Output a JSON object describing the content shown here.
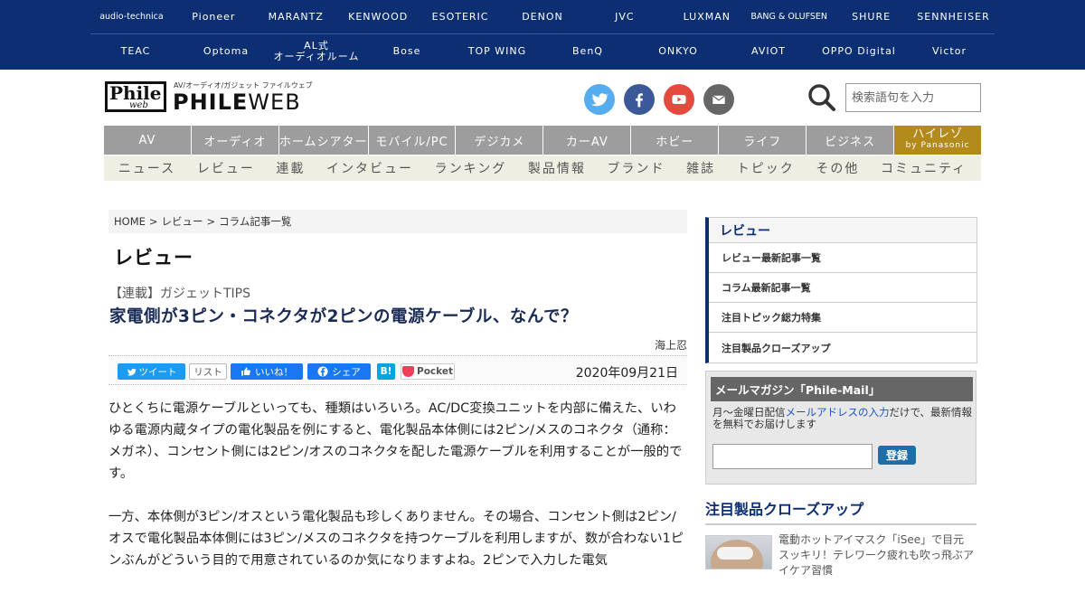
{
  "brandbar": {
    "row1": [
      "audio-technica",
      "Pioneer",
      "MARANTZ",
      "KENWOOD",
      "ESOTERIC",
      "DENON",
      "JVC",
      "LUXMAN",
      "BANG & OLUFSEN",
      "SHURE",
      "SENNHEISER"
    ],
    "row2": [
      "TEAC",
      "Optoma",
      "AL式\nオーディオルーム",
      "Bose",
      "TOP WING",
      "BenQ",
      "ONKYO",
      "AVIOT",
      "OPPO Digital",
      "Victor"
    ]
  },
  "logo": {
    "box_letters": "Phile",
    "box_sub": "web",
    "tagline": "AV/オーディオ/ガジェット ファイルウェブ",
    "name_bold": "PHILE",
    "name_light": "WEB"
  },
  "social_icons": [
    "twitter-icon",
    "facebook-icon",
    "youtube-icon",
    "mail-icon"
  ],
  "colors": {
    "twitter": "#55acee",
    "facebook": "#3b5998",
    "youtube": "#e24b3d",
    "mail": "#666666",
    "brandbar": "#0c2e72",
    "hires": "#b38a1c"
  },
  "search": {
    "placeholder": "検索語句を入力"
  },
  "categories": [
    "AV",
    "オーディオ",
    "ホームシアター",
    "モバイル/PC",
    "デジカメ",
    "カーAV",
    "ホビー",
    "ライフ",
    "ビジネス"
  ],
  "hires": {
    "label": "ハイレゾ",
    "sub": "by Panasonic"
  },
  "subnav": [
    "ニュース",
    "レビュー",
    "連載",
    "インタビュー",
    "ランキング",
    "製品情報",
    "ブランド",
    "雑誌",
    "トピック",
    "その他",
    "コミュニティ"
  ],
  "breadcrumb": {
    "home": "HOME",
    "sep": ">",
    "review": "レビュー",
    "column": "コラム記事一覧"
  },
  "article": {
    "section": "レビュー",
    "series": "【連載】ガジェットTIPS",
    "title": "家電側が3ピン・コネクタが2ピンの電源ケーブル、なんで？",
    "author": "海上忍",
    "date": "2020年09月21日",
    "paragraphs": [
      "ひとくちに電源ケーブルといっても、種類はいろいろ。AC/DC変換ユニットを内部に備えた、いわゆる電源内蔵タイプの電化製品を例にすると、電化製品本体側には2ピン/メスのコネクタ（通称：メガネ）、コンセント側には2ピン/オスのコネクタを配した電源ケーブルを利用することが一般的です。",
      "一方、本体側が3ピン/オスという電化製品も珍しくありません。その場合、コンセント側は2ピン/オスで電化製品本体側には3ピン/メスのコネクタを持つケーブルを利用しますが、数が合わない1ピンぶんがどういう目的で用意されているのか気になりますよね。2ピンで入力した電気"
    ]
  },
  "share": {
    "tweet": "ツイート",
    "list": "リスト",
    "like": "いいね！",
    "fbshare": "シェア",
    "hatena": "B!",
    "pocket": "Pocket"
  },
  "sidebar": {
    "menu_title": "レビュー",
    "menu_items": [
      "レビュー最新記事一覧",
      "コラム最新記事一覧",
      "注目トピック総力特集",
      "注目製品クローズアップ"
    ],
    "mail": {
      "title": "メールマガジン「Phile-Mail」",
      "desc_before": "月～金曜日配信",
      "desc_link": "メールアドレスの入力",
      "desc_after": "だけで、最新情報を無料でお届けします",
      "button": "登録"
    },
    "feature_title": "注目製品クローズアップ",
    "feature_text": "電動ホットアイマスク「iSee」で目元スッキリ！テレワーク疲れも吹っ飛ぶアイケア習慣"
  }
}
